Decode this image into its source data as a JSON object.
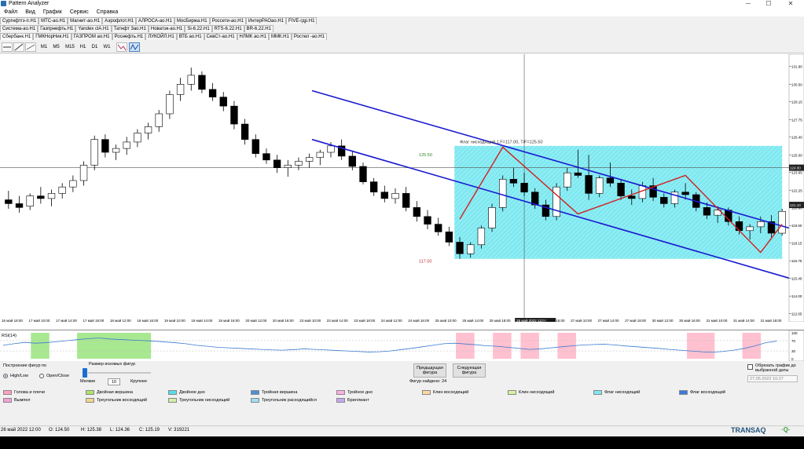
{
  "window": {
    "title": "Pattern Analyzer",
    "minimize": "─",
    "maximize": "☐",
    "close": "✕"
  },
  "menu": [
    "Файл",
    "Вид",
    "График",
    "Сервис",
    "Справка"
  ],
  "tabs": {
    "row1": [
      "Сургнфтгз-п.H1",
      "МТС-ао.H1",
      "Магнит-ао.H1",
      "Аэрофлот.H1",
      "АЛРОСА-ао.H1",
      "МосБиржа.H1",
      "Россети-ао.H1",
      "ИнтерРАОао.H1",
      "FIVE-гдр.H1"
    ],
    "row2": [
      "Система-ао.H1",
      "Газпрнефть.H1",
      "Yandex clA.H1",
      "Татнфт 3ао.H1",
      "Новатэк-ао.H1",
      "Si-6.22.H1",
      "RTS-6.22.H1",
      "BR-6.22.H1"
    ],
    "row3": [
      "Сбербанк.H1",
      "ГМКНорНик.H1",
      "ГАЗПРОМ ао.H1",
      "Роснефть.H1",
      "ЛУКОЙЛ.H1",
      "ВТБ ао.H1",
      "СевСт-ао.H1",
      "НЛМК ао.H1",
      "ММК.H1",
      "Ростел -ао.H1"
    ],
    "active": "Сбербанк.H1"
  },
  "toolbar": {
    "timeframes": [
      "M1",
      "M5",
      "M15",
      "H1",
      "D1",
      "W1"
    ]
  },
  "chart_data": {
    "type": "candlestick",
    "instrument": "Сбербанк.H1",
    "price_axis": {
      "ticks": [
        "131.90",
        "130.50",
        "129.15",
        "127.75",
        "126.40",
        "125.00",
        "123.65",
        "122.25",
        "120.90",
        "119.50",
        "118.15",
        "116.75",
        "115.40",
        "114.00",
        "112.65"
      ],
      "current_price": "124.00",
      "current_price_2": "121.10"
    },
    "time_axis": [
      "16 май 18:00",
      "17 май 10:00",
      "17 май 14:00",
      "17 май 18:00",
      "18 май 12:00",
      "18 май 16:00",
      "19 май 10:00",
      "19 май 14:00",
      "19 май 18:00",
      "20 май 12:00",
      "20 май 16:00",
      "23 май 10:00",
      "23 май 14:00",
      "23 май 18:00",
      "24 май 12:00",
      "24 май 16:00",
      "25 май 10:00",
      "25 май 14:00",
      "25 май 18:00",
      "26 май 2022 12:00",
      "26 май 16:00",
      "27 май 10:00",
      "27 май 14:00",
      "27 май 18:00",
      "30 май 12:00",
      "30 май 16:00",
      "31 май 10:00",
      "31 май 14:00",
      "31 май 18:00"
    ],
    "ohlc": [
      [
        121.5,
        122.2,
        120.8,
        121.2
      ],
      [
        121.2,
        121.8,
        120.5,
        120.9
      ],
      [
        121.0,
        122.0,
        120.7,
        121.8
      ],
      [
        121.8,
        122.5,
        121.2,
        121.6
      ],
      [
        121.6,
        122.3,
        121.0,
        122.0
      ],
      [
        122.0,
        122.8,
        121.6,
        122.5
      ],
      [
        122.5,
        123.4,
        122.1,
        123.0
      ],
      [
        123.0,
        124.5,
        122.6,
        124.2
      ],
      [
        124.2,
        126.5,
        123.8,
        126.2
      ],
      [
        126.2,
        126.6,
        124.8,
        125.2
      ],
      [
        125.2,
        125.8,
        124.6,
        125.5
      ],
      [
        125.5,
        126.4,
        125.0,
        126.0
      ],
      [
        126.0,
        127.0,
        125.6,
        126.7
      ],
      [
        126.7,
        127.5,
        126.2,
        127.2
      ],
      [
        127.2,
        128.5,
        126.8,
        128.2
      ],
      [
        128.2,
        130.0,
        127.8,
        129.7
      ],
      [
        129.7,
        131.0,
        129.2,
        130.5
      ],
      [
        130.5,
        131.8,
        130.0,
        131.2
      ],
      [
        131.2,
        131.5,
        129.8,
        130.1
      ],
      [
        130.1,
        130.6,
        129.2,
        129.5
      ],
      [
        129.5,
        129.9,
        128.4,
        128.8
      ],
      [
        128.8,
        129.2,
        127.0,
        127.4
      ],
      [
        127.4,
        127.8,
        125.8,
        126.2
      ],
      [
        126.2,
        126.6,
        124.8,
        125.1
      ],
      [
        125.1,
        125.5,
        124.3,
        124.6
      ],
      [
        124.6,
        125.0,
        123.6,
        124.0
      ],
      [
        124.0,
        124.6,
        123.3,
        124.2
      ],
      [
        124.2,
        124.8,
        123.8,
        124.5
      ],
      [
        124.5,
        125.1,
        124.0,
        124.8
      ],
      [
        124.8,
        125.4,
        124.2,
        125.2
      ],
      [
        125.2,
        126.0,
        124.8,
        125.7
      ],
      [
        125.7,
        126.2,
        124.6,
        124.9
      ],
      [
        124.9,
        125.3,
        123.8,
        124.1
      ],
      [
        124.1,
        124.4,
        122.7,
        122.9
      ],
      [
        122.9,
        123.2,
        121.8,
        122.1
      ],
      [
        122.1,
        122.6,
        121.3,
        121.6
      ],
      [
        121.6,
        122.4,
        121.2,
        122.0
      ],
      [
        122.0,
        122.5,
        120.6,
        120.9
      ],
      [
        120.9,
        121.4,
        119.8,
        120.2
      ],
      [
        120.2,
        120.7,
        119.2,
        119.6
      ],
      [
        119.6,
        120.1,
        118.7,
        119.0
      ],
      [
        119.0,
        119.4,
        117.9,
        118.2
      ],
      [
        118.2,
        118.6,
        116.9,
        117.3
      ],
      [
        117.3,
        118.2,
        117.0,
        118.0
      ],
      [
        118.0,
        119.5,
        117.7,
        119.3
      ],
      [
        119.3,
        121.2,
        119.0,
        120.9
      ],
      [
        120.9,
        123.4,
        120.6,
        123.1
      ],
      [
        123.1,
        124.0,
        122.5,
        122.8
      ],
      [
        122.8,
        123.6,
        121.8,
        122.1
      ],
      [
        122.1,
        122.4,
        120.8,
        121.1
      ],
      [
        121.1,
        121.5,
        119.9,
        120.2
      ],
      [
        120.2,
        122.8,
        119.9,
        122.5
      ],
      [
        122.5,
        124.0,
        122.2,
        123.6
      ],
      [
        123.6,
        125.4,
        123.2,
        123.4
      ],
      [
        123.4,
        125.0,
        121.5,
        122.0
      ],
      [
        122.0,
        123.4,
        121.7,
        123.2
      ],
      [
        123.2,
        124.4,
        122.5,
        122.8
      ],
      [
        122.8,
        123.1,
        121.5,
        121.8
      ],
      [
        121.8,
        122.3,
        121.1,
        121.6
      ],
      [
        121.6,
        122.9,
        121.3,
        122.6
      ],
      [
        122.6,
        123.2,
        121.4,
        121.7
      ],
      [
        121.7,
        122.0,
        120.9,
        121.2
      ],
      [
        121.2,
        122.3,
        120.9,
        122.1
      ],
      [
        122.1,
        122.8,
        121.5,
        121.9
      ],
      [
        121.9,
        122.1,
        120.6,
        120.9
      ],
      [
        120.9,
        121.3,
        120.0,
        120.3
      ],
      [
        120.3,
        121.0,
        119.7,
        120.7
      ],
      [
        120.7,
        120.9,
        119.5,
        119.8
      ],
      [
        119.8,
        120.2,
        118.8,
        119.1
      ],
      [
        119.1,
        119.6,
        118.4,
        119.4
      ],
      [
        119.4,
        120.2,
        118.9,
        119.8
      ],
      [
        119.8,
        120.3,
        118.6,
        118.9
      ],
      [
        118.9,
        120.8,
        118.7,
        120.6
      ]
    ],
    "annotations": {
      "flag_label": "Флаг нисходящий 1,F=117.00, T/F=125.50",
      "target_label": "125.50",
      "floor_label": "117.00",
      "pattern_start_ratio": 0.58,
      "pattern_end_ratio": 0.97
    }
  },
  "rsi": {
    "label": "RSI(14)",
    "ticks": [
      "100",
      "70",
      "30",
      "0"
    ],
    "values": [
      52,
      58,
      63,
      60,
      62,
      66,
      70,
      74,
      78,
      80,
      76,
      74,
      72,
      70,
      68,
      65,
      62,
      58,
      52,
      48,
      44,
      42,
      40,
      38,
      36,
      34,
      33,
      35,
      38,
      36,
      34,
      32,
      30,
      28,
      26,
      27,
      30,
      35,
      40,
      46,
      52,
      58,
      60,
      57,
      54,
      50,
      48,
      44,
      40,
      36,
      38,
      42,
      46,
      50,
      53,
      55,
      56,
      53,
      49,
      46,
      43,
      40,
      36,
      33,
      30,
      27,
      25,
      28,
      33,
      40,
      50,
      62,
      68
    ]
  },
  "panel": {
    "build_title": "Построение фигур по",
    "opt_highlow": "High/Low",
    "opt_openclose": "Open/Close",
    "size_title": "Размер искомых фигур",
    "size_small": "Мелкие",
    "size_value": "10",
    "size_large": "Крупнее",
    "btn_prev": "Предыдущая фигура",
    "btn_next": "Следующая фигура",
    "found_label": "Фигур найдено: 24",
    "crop_label": "Обрезать график до выбранной даты",
    "date_value": "27.05.2022 10:27",
    "legend": [
      {
        "name": "Голова и плечи",
        "color": "#ff9fc6"
      },
      {
        "name": "Двойная вершина",
        "color": "#aee46a"
      },
      {
        "name": "Двойное дно",
        "color": "#55dfe8"
      },
      {
        "name": "Тройная вершина",
        "color": "#4f8fd8"
      },
      {
        "name": "Тройное дно",
        "color": "#ffb0e0"
      },
      {
        "name": "Клин восходящий",
        "color": "#ffd7a0"
      },
      {
        "name": "Клин нисходящий",
        "color": "#d6f2a0"
      },
      {
        "name": "Флаг нисходящий",
        "color": "#7ee7ef"
      },
      {
        "name": "Флаг восходящий",
        "color": "#3a7ae0"
      },
      {
        "name": "Вымпел",
        "color": "#f6a0d8"
      },
      {
        "name": "Треугольник восходящий",
        "color": "#f5d78c"
      },
      {
        "name": "Треугольник нисходящий",
        "color": "#d4f0a8"
      },
      {
        "name": "Треугольник расходящийся",
        "color": "#9ee0f4"
      },
      {
        "name": "Бриллиант",
        "color": "#c8a8f0"
      }
    ]
  },
  "status": {
    "date": "26 май 2022 12:00",
    "open": "O: 124.50",
    "high": "H: 125.38",
    "low": "L: 124.36",
    "close": "C: 125.19",
    "volume": "V: 319221",
    "brand": "TRANSAQ",
    "brand_suffix": "·Q·"
  }
}
